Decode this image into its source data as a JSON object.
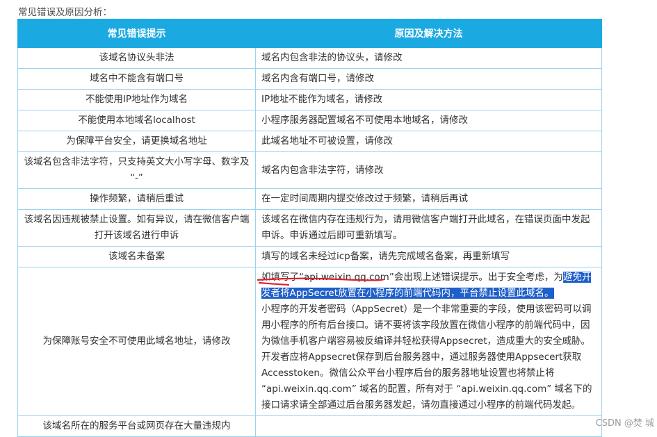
{
  "intro": "常见错误及原因分析：",
  "table": {
    "headers": [
      "常见错误提示",
      "原因及解决方法"
    ],
    "rows": [
      {
        "error": "该域名协议头非法",
        "reason": "域名内包含非法的协议头，请修改"
      },
      {
        "error": "域名中不能含有端口号",
        "reason": "域名内含有端口号，请修改"
      },
      {
        "error": "不能使用IP地址作为域名",
        "reason": "IP地址不能作为域名，请修改"
      },
      {
        "error": "不能使用本地域名localhost",
        "reason": "小程序服务器配置域名不可使用本地域名，请修改"
      },
      {
        "error": "为保障平台安全，请更换域名地址",
        "reason": "此域名地址不可被设置，请修改"
      },
      {
        "error": "该域名包含非法字符，只支持英文大小写字母、数字及 “-”",
        "reason": "域名内包含非法字符，请修改"
      },
      {
        "error": "操作频繁，请稍后重试",
        "reason": "在一定时间周期内提交修改过于频繁，请稍后再试"
      },
      {
        "error": "该域名因违规被禁止设置。如有异议，请在微信客户端打开该域名进行申诉",
        "reason": "该域名在微信内存在违规行为，请用微信客户端打开此域名，在错误页面中发起申诉。申诉通过后即可重新填写。"
      },
      {
        "error": "该域名未备案",
        "reason": "填写的域名未经过icp备案，请先完成域名备案，再重新填写"
      }
    ],
    "big_row": {
      "error": "为保障账号安全不可使用此域名地址，请修改",
      "reason_pre": "如填写了“api.weixin.qq.com”会出现上述错误提示。出于安全考虑，为",
      "reason_highlight": "避免开发者将AppSecret放置在小程序的前端代码内，平台禁止设置此域名。",
      "reason_post": "小程序的开发者密码（AppSecret）是一个非常重要的字段，使用该密码可以调用小程序的所有后台接口。请不要将该字段放置在微信小程序的前端代码中，因为微信手机客户端容易被反编译并轻松获得Appsecret，造成重大的安全威胁。开发者应将Appsecret保存到后台服务器中，通过服务器使用Appsecert获取Accesstoken。微信公众平台小程序后台的服务器地址设置也将禁止将 “api.weixin.qq.com” 域名的配置，所有对于 “api.weixin.qq.com” 域名下的接口请求请全部通过后台服务器发起，请勿直接通过小程序的前端代码发起。"
    },
    "last_row": {
      "error": "该域名所在的服务平台或网页存在大量违规内",
      "reason": ""
    }
  },
  "watermark": "CSDN @焚 城",
  "colors": {
    "header_bg": "#1ba9e1",
    "highlight_bg": "#1f5fc9",
    "underline": "#e0202a",
    "border": "#9bd3ec"
  }
}
